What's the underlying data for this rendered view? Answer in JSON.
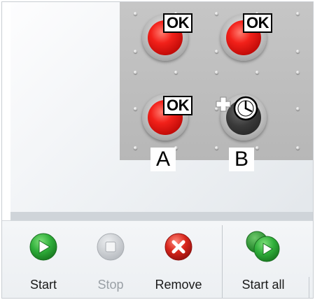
{
  "panel": {
    "lamps": [
      {
        "id": "top-left",
        "state": "red",
        "badge": "OK"
      },
      {
        "id": "top-right",
        "state": "red",
        "badge": "OK"
      },
      {
        "id": "lamp-a",
        "state": "red",
        "badge": "OK",
        "label": "A"
      },
      {
        "id": "lamp-b",
        "state": "dark",
        "badge_icon": "add-timer-icon",
        "label": "B"
      }
    ]
  },
  "toolbar": {
    "start_label": "Start",
    "stop_label": "Stop",
    "remove_label": "Remove",
    "start_all_label": "Start all"
  },
  "colors": {
    "start_green": "#2fae3a",
    "remove_red": "#d8261c",
    "disabled_gray": "#bfc3c8",
    "lamp_red": "#f2211a",
    "panel_gray": "#bcbcbc"
  }
}
